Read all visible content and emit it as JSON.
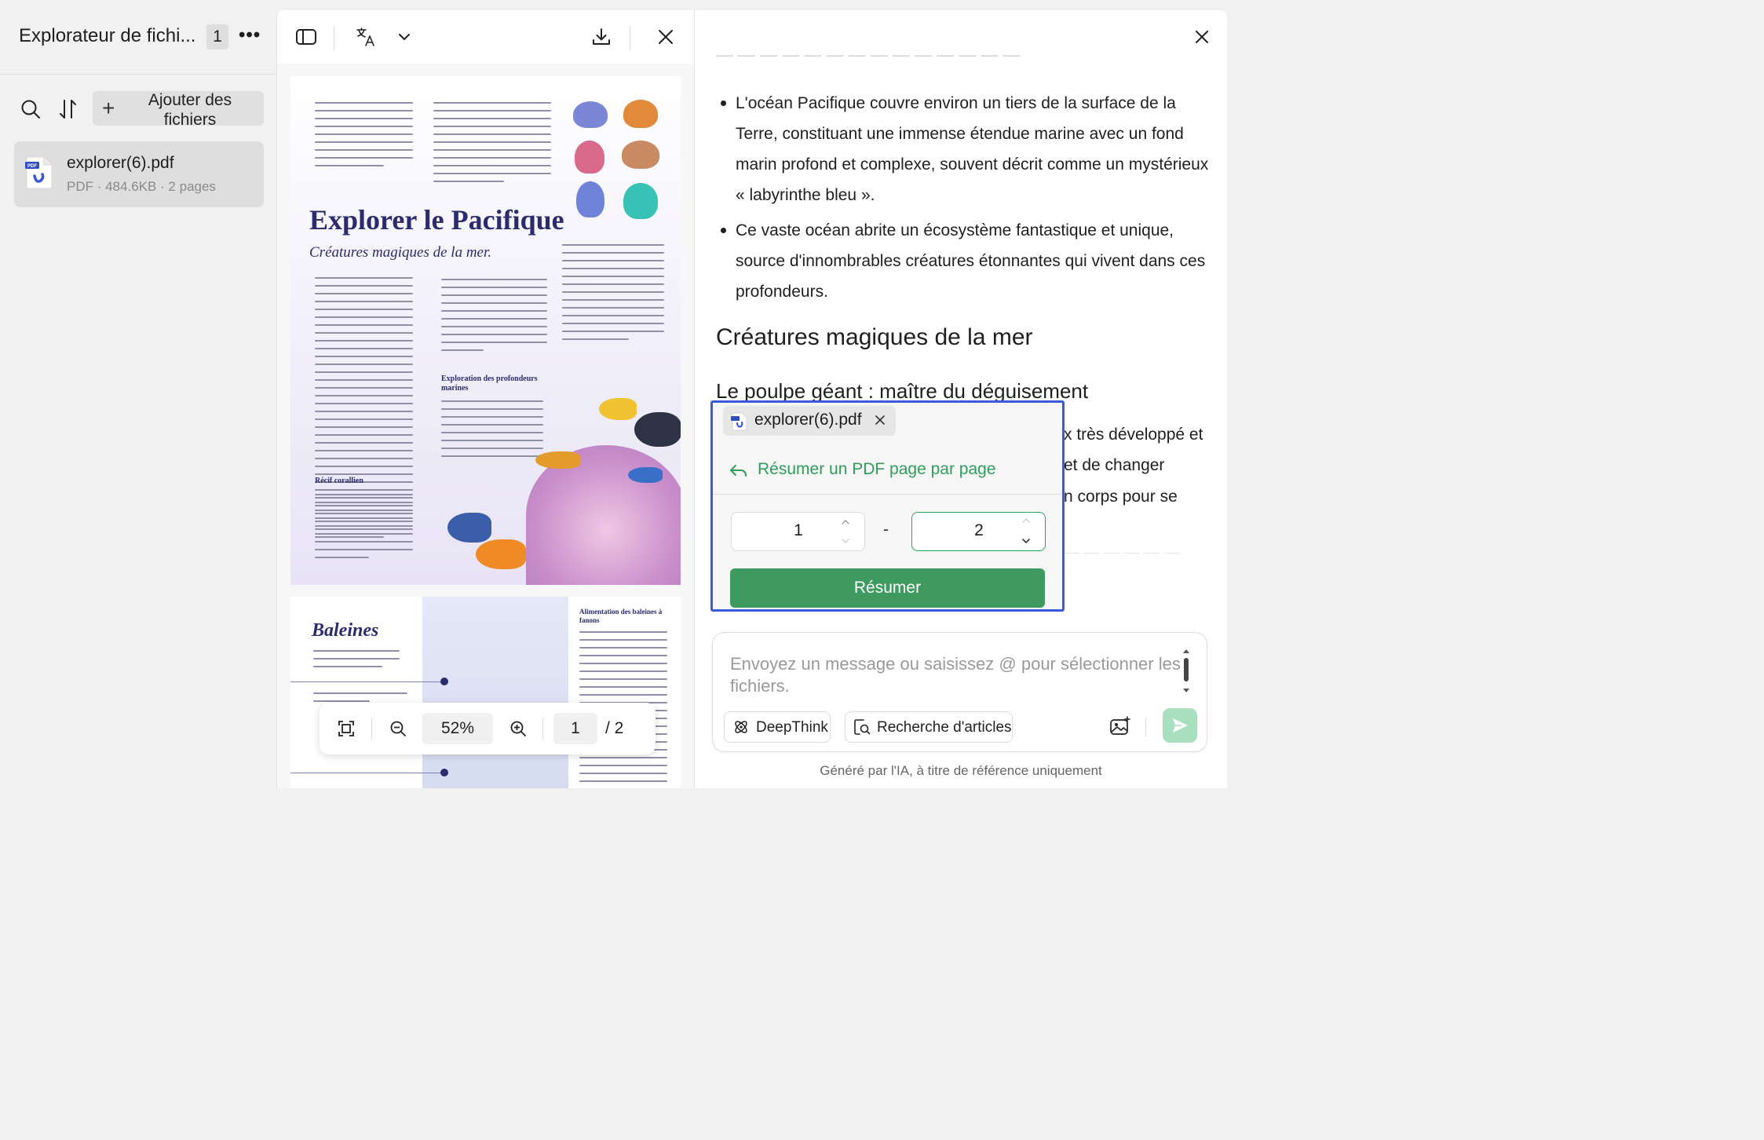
{
  "explorer": {
    "title": "Explorateur de fichi...",
    "count": "1",
    "more_label": "•••",
    "add_files_label": "Ajouter des fichiers",
    "files": [
      {
        "name": "explorer(6).pdf",
        "meta": "PDF · 484.6KB · 2 pages"
      }
    ]
  },
  "viewer": {
    "page1": {
      "title": "Explorer le Pacifique",
      "subtitle": "Créatures magiques de la mer.",
      "section1": "Récif corallien",
      "section2": "Exploration des profondeurs marines"
    },
    "page2": {
      "title": "Baleines",
      "section": "Alimentation des baleines à fanons"
    },
    "zoom": "52%",
    "current_page": "1",
    "total_pages": "/ 2"
  },
  "assistant": {
    "bullets": [
      "L'océan Pacifique couvre environ un tiers de la surface de la Terre, constituant une immense étendue marine avec un fond marin profond et complexe, souvent décrit comme un mystérieux « labyrinthe bleu ».",
      "Ce vaste océan abrite un écosystème fantastique et unique, source d'innombrables créatures étonnantes qui vivent dans ces profondeurs."
    ],
    "heading": "Créatures magiques de la mer",
    "subheading": "Le poulpe géant : maître du déguisement",
    "peek_lines": [
      "x très développé et",
      "et de changer",
      "n corps pour se"
    ],
    "popup": {
      "file_chip": "explorer(6).pdf",
      "action_label": "Résumer un PDF page par page",
      "from_page": "1",
      "range_separator": "-",
      "to_page": "2",
      "submit_label": "Résumer"
    },
    "input": {
      "placeholder": "Envoyez un message ou saisissez @ pour sélectionner les fichiers.",
      "deepthink_label": "DeepThink",
      "search_label": "Recherche d'articles"
    },
    "footer": "Généré par l'IA, à titre de référence uniquement",
    "colors": {
      "accent": "#2e9e5a",
      "button": "#3f9a60",
      "highlight_border": "#3b5bdb",
      "send_disabled": "#a8dfbf"
    }
  }
}
